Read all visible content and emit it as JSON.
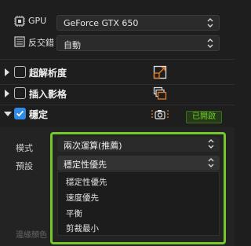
{
  "gpu": {
    "label": "GPU",
    "value": "GeForce GTX 650"
  },
  "interlace": {
    "label": "反交錯",
    "value": "自動"
  },
  "sections": [
    {
      "title": "超解析度",
      "checked": false,
      "expanded": false,
      "icon": "resize-icon"
    },
    {
      "title": "插入影格",
      "checked": false,
      "expanded": false,
      "icon": "frames-icon"
    },
    {
      "title": "穩定",
      "checked": true,
      "expanded": true,
      "icon": "camera-icon",
      "badge": "已開啟"
    }
  ],
  "stabilize": {
    "mode_label": "模式",
    "mode_value": "兩次運算(推薦)",
    "preset_label": "預設",
    "preset_value": "穩定性優先",
    "preset_options": [
      "穩定性優先",
      "速度優先",
      "平衡",
      "剪裁最小"
    ],
    "faded_label": "邊緣顏色"
  },
  "colors": {
    "accent_green": "#76c72b",
    "checkbox_blue": "#2f8be6",
    "icon_orange": "#e87b22",
    "badge_green": "#6ed12a"
  }
}
